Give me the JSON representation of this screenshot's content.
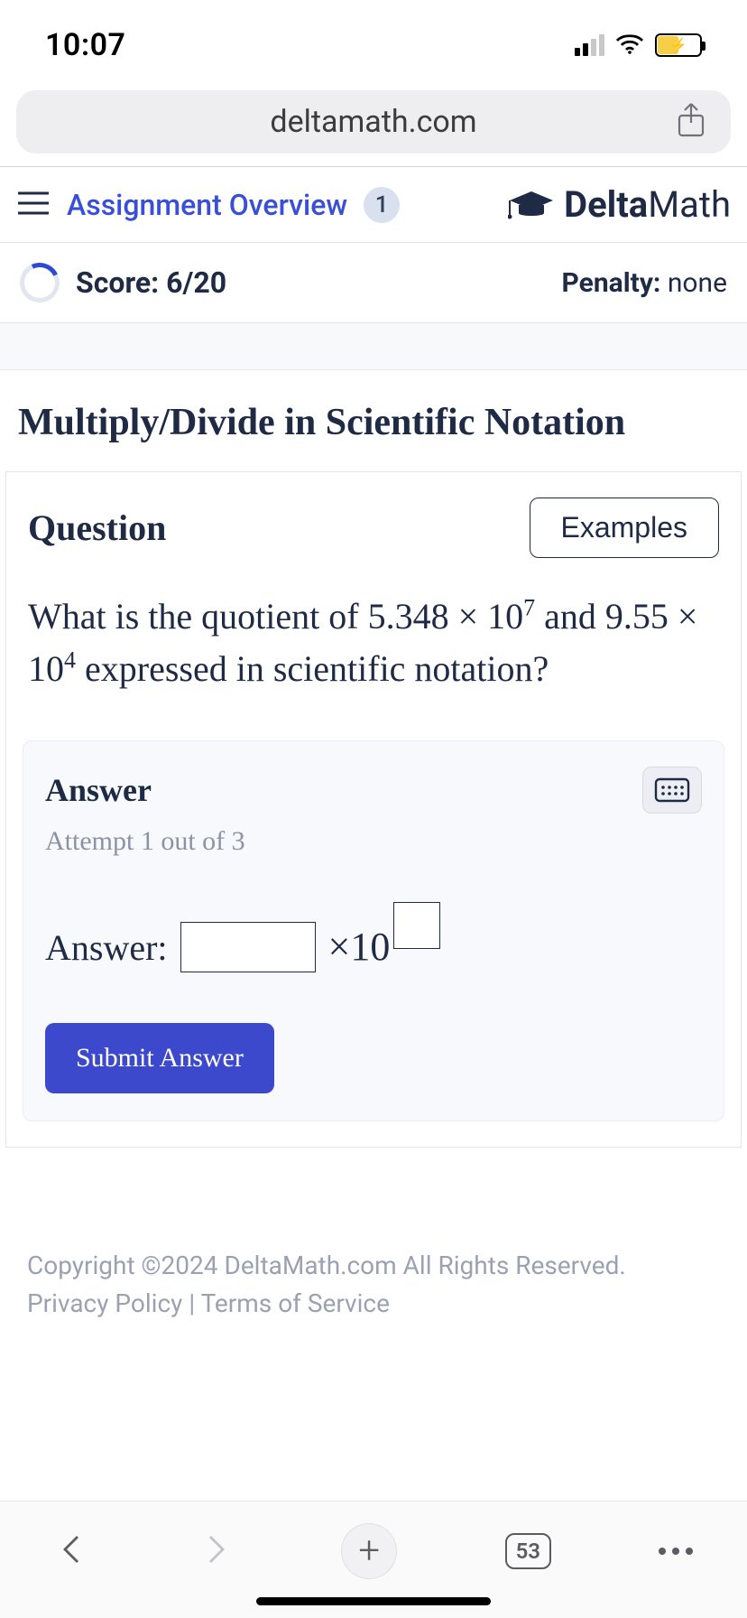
{
  "status": {
    "time": "10:07"
  },
  "browser": {
    "url": "deltamath.com",
    "tab_count": "53"
  },
  "header": {
    "assignment_link": "Assignment Overview",
    "badge": "1",
    "logo_bold": "Delta",
    "logo_light": "Math"
  },
  "score": {
    "label": "Score: 6/20",
    "penalty_label": "Penalty:",
    "penalty_value": "none"
  },
  "page_title": "Multiply/Divide in Scientific Notation",
  "question": {
    "label": "Question",
    "examples_btn": "Examples",
    "text_pre": "What is the quotient of ",
    "op1_coef": "5.348",
    "op1_exp": "7",
    "text_mid": " and ",
    "op2_coef": "9.55",
    "op2_exp": "4",
    "text_post": " expressed in scientific notation?"
  },
  "answer": {
    "title": "Answer",
    "attempt": "Attempt 1 out of 3",
    "row_label": "Answer:",
    "times": "×10",
    "submit": "Submit Answer",
    "coef_value": "",
    "exp_value": ""
  },
  "footer": {
    "copyright": "Copyright ©2024 DeltaMath.com All Rights Reserved.",
    "privacy": "Privacy Policy",
    "sep": " | ",
    "terms": "Terms of Service"
  }
}
